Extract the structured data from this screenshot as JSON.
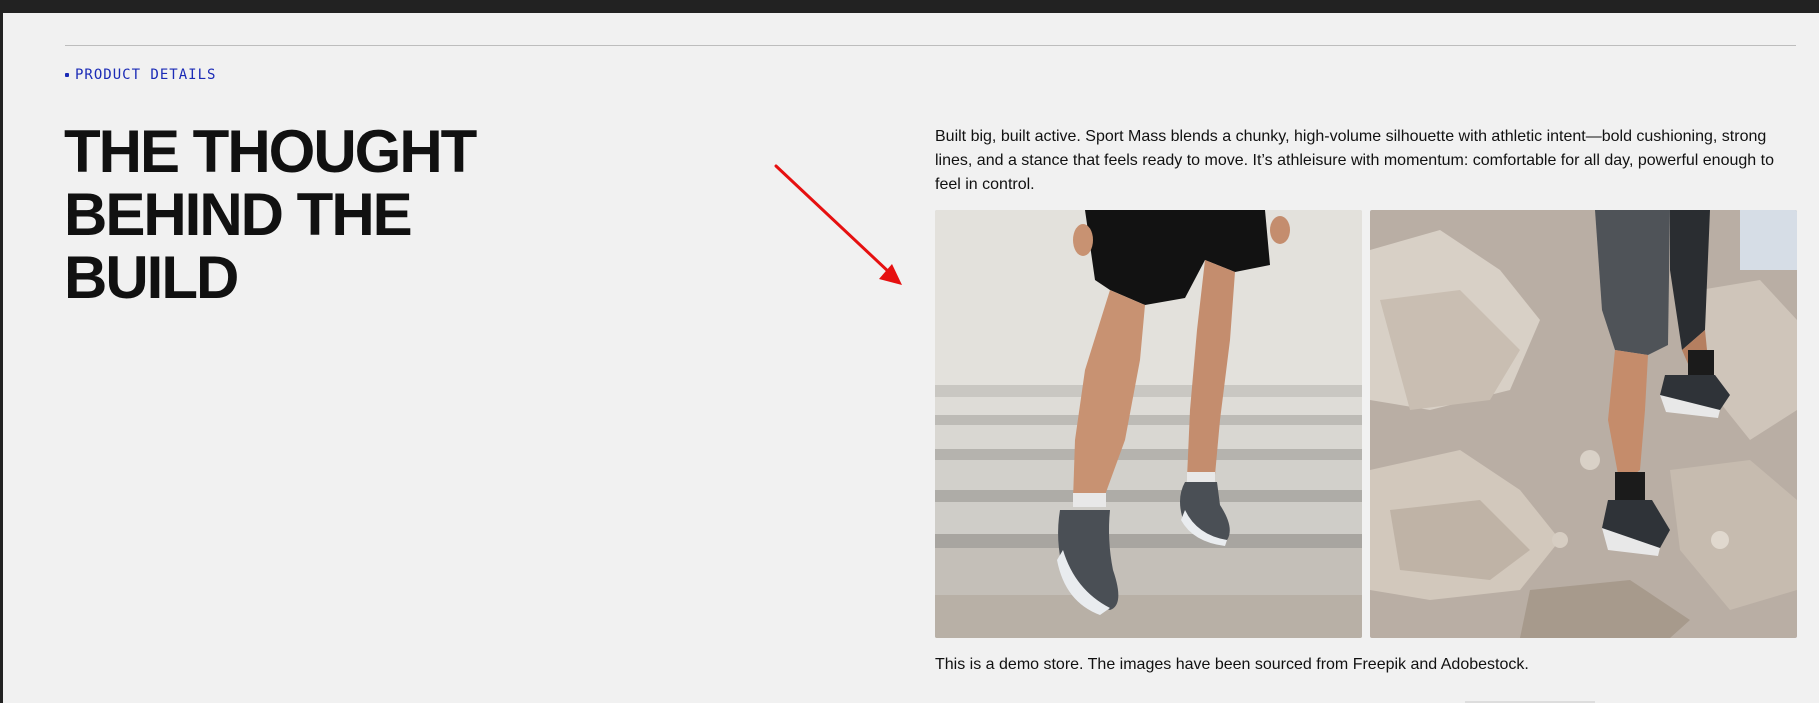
{
  "section": {
    "eyebrow": "PRODUCT DETAILS",
    "headline": "THE THOUGHT BEHIND THE BUILD",
    "description": "Built big, built active. Sport Mass blends a chunky, high-volume silhouette with athletic intent—bold cushioning, strong lines, and a stance that feels ready to move. It’s athleisure with momentum: comfortable for all day, powerful enough to feel in control.",
    "note": "This is a demo store. The images have been sourced from Freepik and Adobestock."
  },
  "colors": {
    "accent": "#1b2bb6",
    "annotation_arrow": "#e61010",
    "background": "#f1f1f1"
  },
  "icons": {
    "annotation": "red-arrow-icon"
  }
}
